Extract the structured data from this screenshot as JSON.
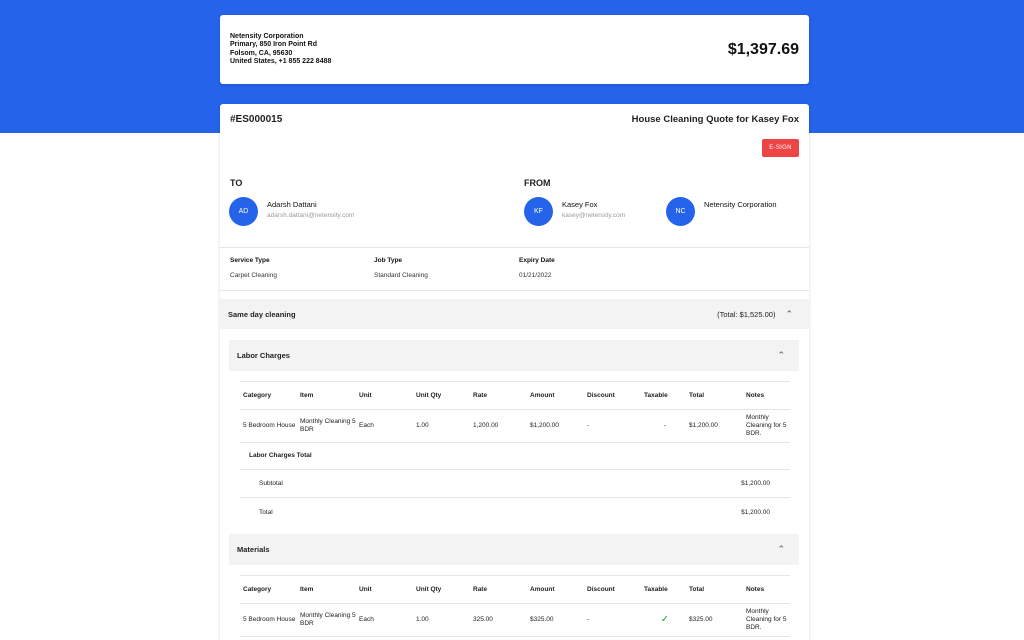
{
  "company": {
    "name": "Netensity Corporation",
    "address_line1": "Primary, 850 Iron Point Rd",
    "address_line2": "Folsom, CA, 95630",
    "address_line3": "United States, +1 855 222 8488"
  },
  "header_total": "$1,397.69",
  "quote": {
    "id": "#ES000015",
    "title": "House Cleaning Quote for Kasey Fox",
    "esign_label": "E-SIGN"
  },
  "to": {
    "label": "TO",
    "initials": "AD",
    "name": "Adarsh Dattani",
    "email": "adarsh.dattani@netensity.com"
  },
  "from": {
    "label": "FROM",
    "person": {
      "initials": "KF",
      "name": "Kasey Fox",
      "email": "kasey@netensity.com"
    },
    "company": {
      "initials": "NC",
      "name": "Netensity Corporation"
    }
  },
  "meta": {
    "service_type_label": "Service Type",
    "service_type": "Carpet Cleaning",
    "job_type_label": "Job Type",
    "job_type": "Standard Cleaning",
    "expiry_label": "Expiry Date",
    "expiry": "01/21/2022"
  },
  "section": {
    "title": "Same day cleaning",
    "total": "(Total: $1,525.00)"
  },
  "columns": [
    "Category",
    "Item",
    "Unit",
    "Unit Qty",
    "Rate",
    "Amount",
    "Discount",
    "Taxable",
    "Total",
    "Notes"
  ],
  "labor": {
    "title": "Labor Charges",
    "row": {
      "category": "5 Bedroom House",
      "item": "Monthly Cleaning 5 BDR",
      "unit": "Each",
      "qty": "1.00",
      "rate": "1,200.00",
      "amount": "$1,200.00",
      "discount": "-",
      "taxable": "-",
      "total": "$1,200.00",
      "notes": "Monthly Cleaning for 5 BDR."
    },
    "totals_label": "Labor Charges Total",
    "subtotal_label": "Subtotal",
    "subtotal": "$1,200.00",
    "total_label": "Total",
    "total": "$1,200.00"
  },
  "materials": {
    "title": "Materials",
    "row": {
      "category": "5 Bedroom House",
      "item": "Monthly Cleaning 5 BDR",
      "unit": "Each",
      "qty": "1.00",
      "rate": "325.00",
      "amount": "$325.00",
      "discount": "-",
      "taxable_icon": "checkmark-icon",
      "total": "$325.00",
      "notes": "Monthly Cleaning for 5 BDR."
    }
  },
  "colors": {
    "brand_blue": "#2563eb",
    "esign_red": "#ef4444",
    "check_green": "#16a34a"
  }
}
